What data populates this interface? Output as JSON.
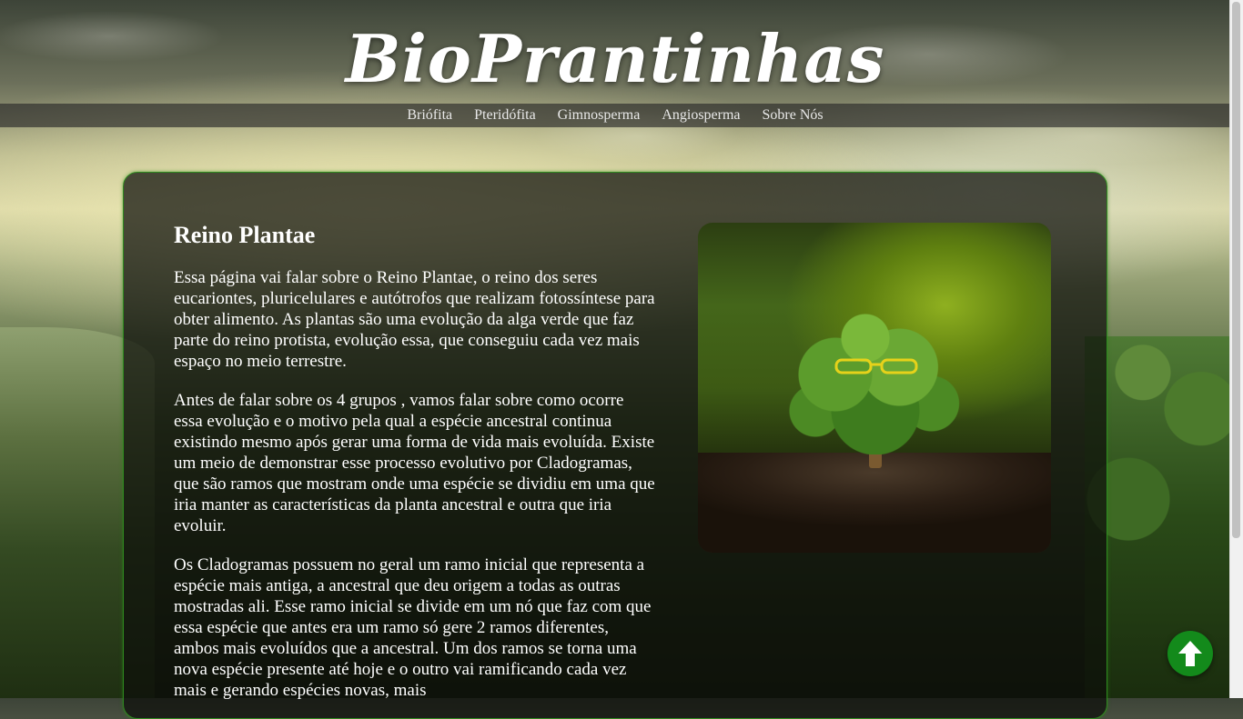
{
  "header": {
    "site_title": "BioPrantinhas"
  },
  "nav": {
    "items": [
      {
        "label": "Briófita"
      },
      {
        "label": "Pteridófita"
      },
      {
        "label": "Gimnosperma"
      },
      {
        "label": "Angiosperma"
      },
      {
        "label": "Sobre Nós"
      }
    ]
  },
  "main": {
    "heading": "Reino Plantae",
    "paragraphs": [
      "Essa página vai falar sobre o Reino Plantae, o reino dos seres eucariontes, pluricelulares e autótrofos que realizam fotossíntese para obter alimento. As plantas são uma evolução da alga verde que faz parte do reino protista, evolução essa, que conseguiu cada vez mais espaço no meio terrestre.",
      "Antes de falar sobre os 4 grupos , vamos falar sobre como ocorre essa evolução e o motivo pela qual a espécie ancestral continua existindo mesmo após gerar uma forma de vida mais evoluída. Existe um meio de demonstrar esse processo evolutivo por Cladogramas, que são ramos que mostram onde uma espécie se dividiu em uma que iria manter as características da planta ancestral e outra que iria evoluir.",
      "Os Cladogramas possuem no geral um ramo inicial que representa a espécie mais antiga, a ancestral que deu origem a todas as outras mostradas ali. Esse ramo inicial se divide em um nó que faz com que essa espécie que antes era um ramo só gere 2 ramos diferentes, ambos mais evoluídos que a ancestral. Um dos ramos se torna uma nova espécie presente até hoje e o outro vai ramificando cada vez mais e gerando espécies novas, mais"
    ]
  },
  "icons": {
    "back_to_top": "arrow-up-icon"
  },
  "colors": {
    "accent_green": "#138a1b",
    "card_border": "#2f8a1f"
  }
}
